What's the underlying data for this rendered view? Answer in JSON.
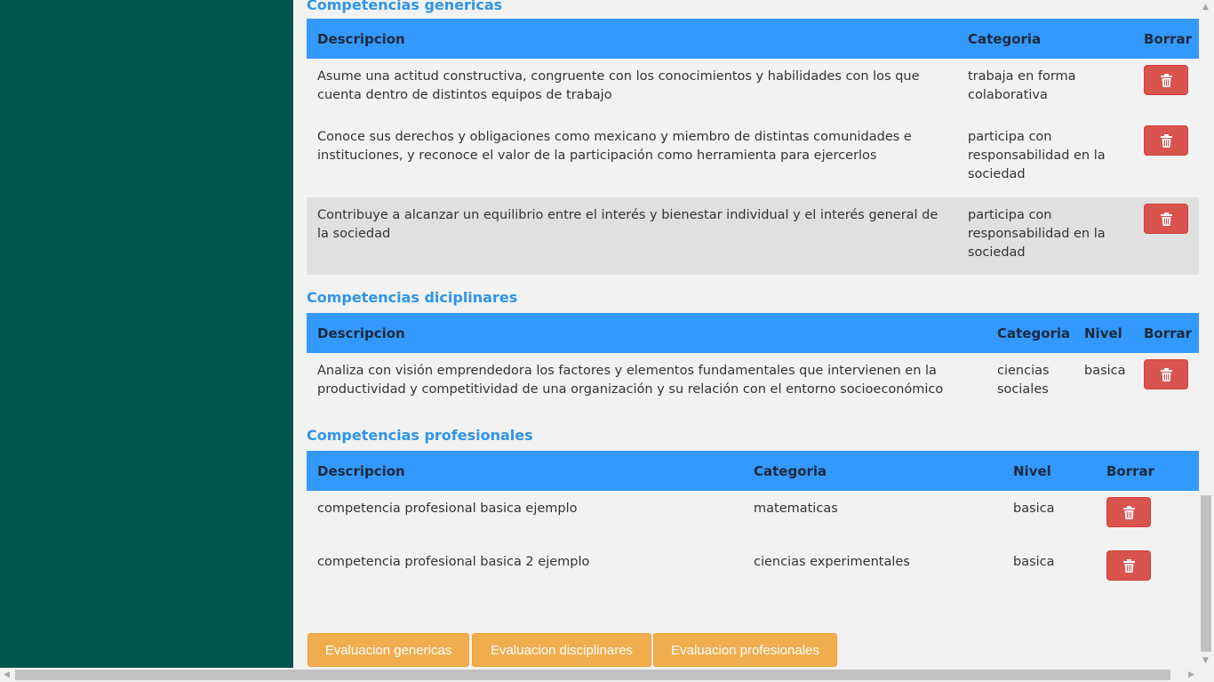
{
  "generic": {
    "title": "Competencias genericas",
    "headers": {
      "description": "Descripcion",
      "category": "Categoria",
      "delete": "Borrar"
    },
    "rows": [
      {
        "description": "Asume una actitud constructiva, congruente con los conocimientos y habilidades con los que cuenta dentro de distintos equipos de trabajo",
        "category": "trabaja en forma colaborativa"
      },
      {
        "description": "Conoce sus derechos y obligaciones como mexicano y miembro de distintas comunidades e instituciones, y reconoce el valor de la participación como herramienta para ejercerlos",
        "category": "participa con responsabilidad en la sociedad"
      },
      {
        "description": "Contribuye a alcanzar un equilibrio entre el interés y bienestar individual y el interés general de la sociedad",
        "category": "participa con responsabilidad en la sociedad"
      }
    ]
  },
  "disciplinary": {
    "title": "Competencias diciplinares",
    "headers": {
      "description": "Descripcion",
      "category": "Categoria",
      "level": "Nivel",
      "delete": "Borrar"
    },
    "rows": [
      {
        "description": "Analiza con visión emprendedora los factores y elementos fundamentales que intervienen en la productividad y competitividad de una organización y su relación con el entorno socioeconómico",
        "category": "ciencias sociales",
        "level": "basica"
      }
    ]
  },
  "professional": {
    "title": "Competencias profesionales",
    "headers": {
      "description": "Descripcion",
      "category": "Categoria",
      "level": "Nivel",
      "delete": "Borrar"
    },
    "rows": [
      {
        "description": "competencia profesional basica ejemplo",
        "category": "matematicas",
        "level": "basica"
      },
      {
        "description": "competencia profesional basica 2 ejemplo",
        "category": "ciencias experimentales",
        "level": "basica"
      }
    ]
  },
  "buttons": {
    "eval_generic": "Evaluacion genericas",
    "eval_disciplinary": "Evaluacion disciplinares",
    "eval_professional": "Evaluacion profesionales"
  },
  "icons": {
    "delete": "trash-icon"
  },
  "colors": {
    "sidebar": "#00564a",
    "header": "#3399ff",
    "title": "#2f95e6",
    "delete": "#d9534f",
    "eval": "#f0ad4e"
  }
}
